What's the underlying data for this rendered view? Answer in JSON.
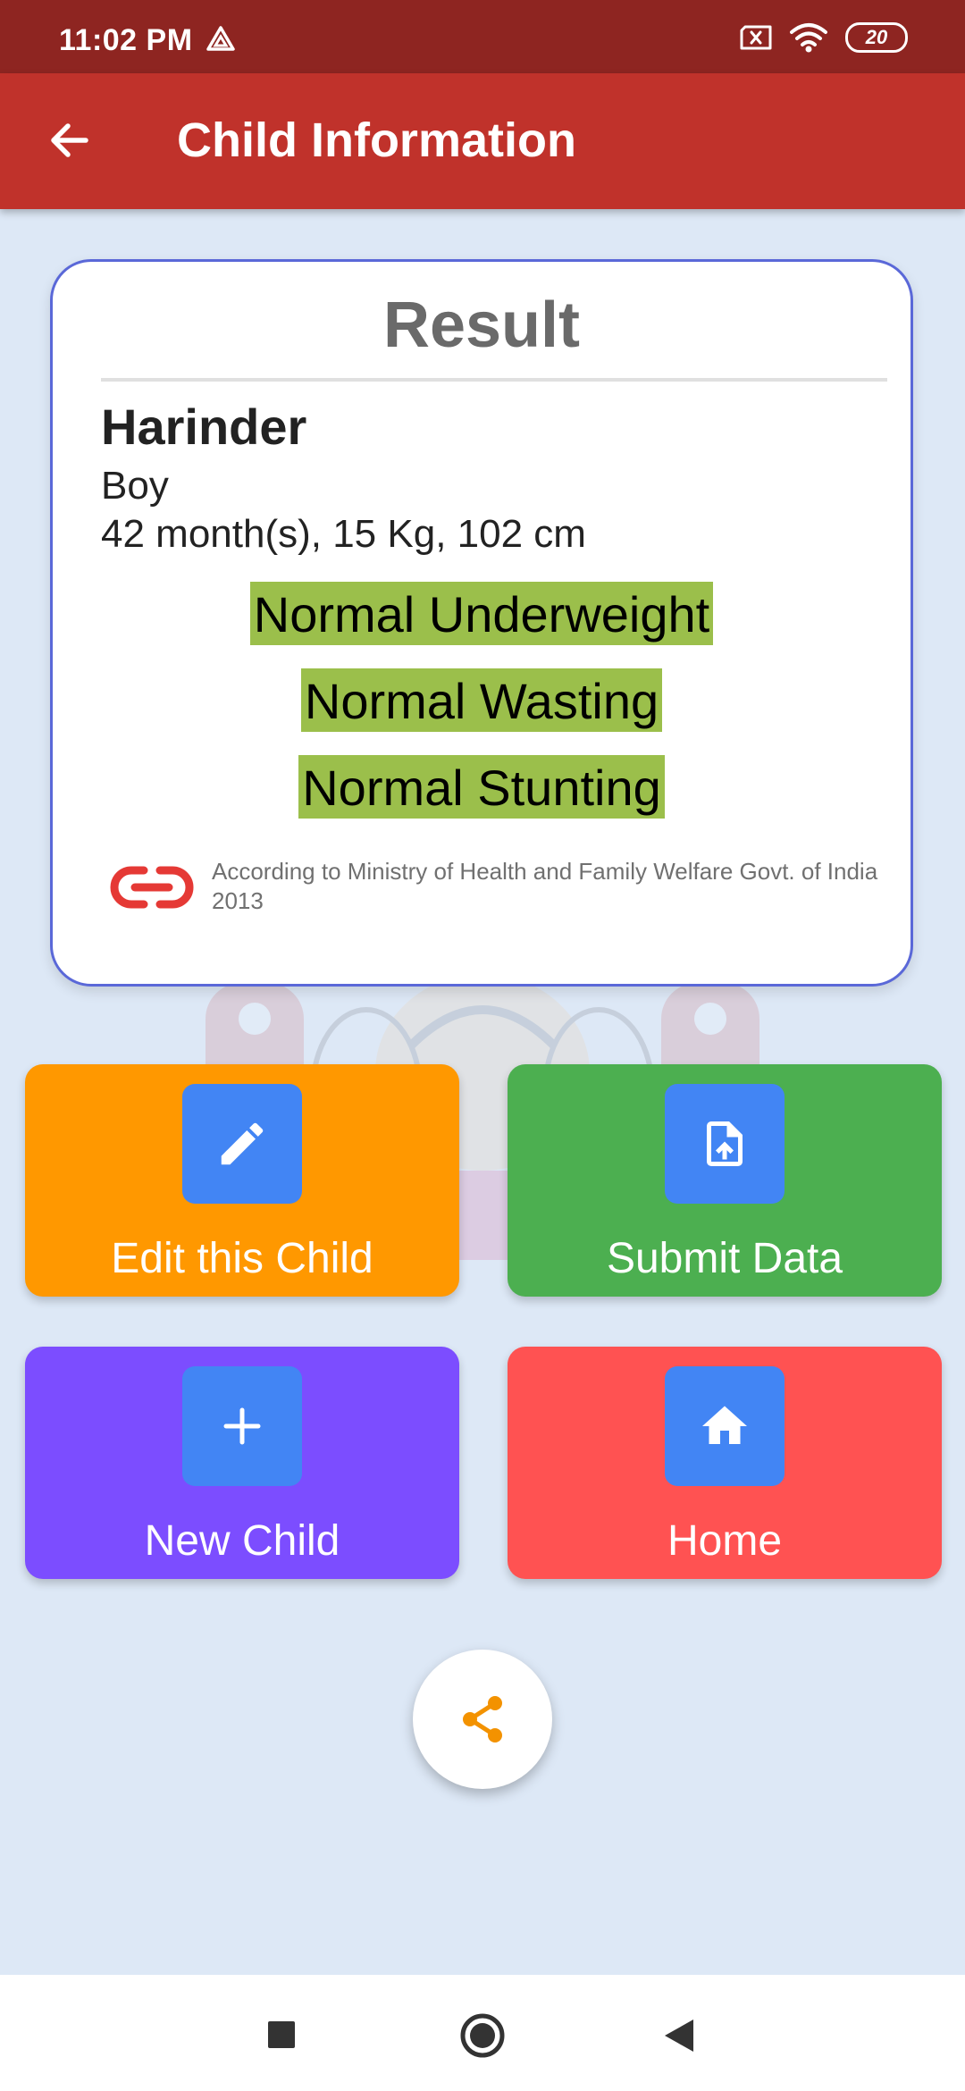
{
  "status_bar": {
    "time": "11:02 PM",
    "battery": "20",
    "icons": [
      "drive-icon",
      "sim-card-icon",
      "wifi-icon",
      "battery-icon"
    ]
  },
  "app_bar": {
    "title": "Child Information",
    "back_icon": "arrow-back-icon"
  },
  "result_card": {
    "title": "Result",
    "child": {
      "name": "Harinder",
      "gender": "Boy",
      "stats": "42 month(s), 15 Kg, 102 cm"
    },
    "statuses": [
      {
        "label": "Normal Underweight"
      },
      {
        "label": "Normal Wasting"
      },
      {
        "label": "Normal Stunting"
      }
    ],
    "source_icon": "link-icon",
    "source": "According to Ministry of Health and Family Welfare Govt. of India 2013"
  },
  "actions": [
    {
      "label": "Edit this Child",
      "icon": "pencil-icon"
    },
    {
      "label": "Submit Data",
      "icon": "file-upload-icon"
    },
    {
      "label": "New Child",
      "icon": "plus-icon"
    },
    {
      "label": "Home",
      "icon": "home-icon"
    }
  ],
  "share_icon": "share-icon",
  "colors": {
    "status_bar": "#8e2521",
    "app_bar": "#c0322b",
    "background": "#dde8f6",
    "card_border": "#5a68d8",
    "status_highlight": "#9bbf4b",
    "edit_button": "#ff9800",
    "submit_button": "#4caf50",
    "new_child_button": "#7c4dff",
    "home_button": "#ff5252",
    "icon_box": "#4285f4",
    "share_icon": "#f39200"
  },
  "nav_bar": {
    "icons": [
      "recent-apps-icon",
      "home-nav-icon",
      "back-nav-icon"
    ]
  }
}
